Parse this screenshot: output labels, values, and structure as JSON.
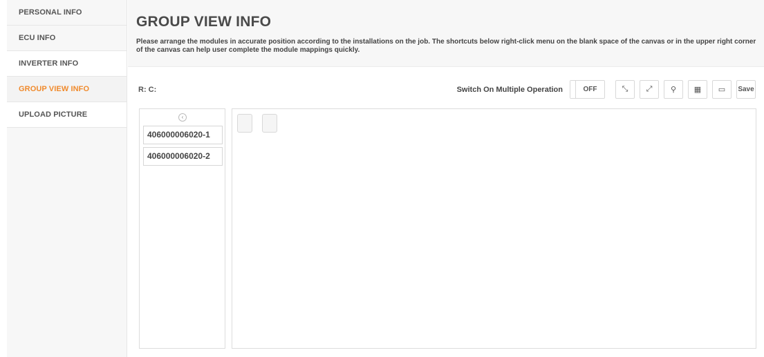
{
  "sidebar": {
    "items": [
      {
        "label": "PERSONAL INFO"
      },
      {
        "label": "ECU INFO"
      },
      {
        "label": "INVERTER INFO"
      },
      {
        "label": "GROUP VIEW INFO"
      },
      {
        "label": "UPLOAD PICTURE"
      }
    ],
    "active_color": "#f08a2c"
  },
  "header": {
    "title": "GROUP VIEW INFO",
    "description": "Please arrange the modules in accurate position according to the installations on the job. The shortcuts below right-click menu on the blank space of the canvas or in the upper right corner of the canvas can help user complete the module mappings quickly."
  },
  "toolbar": {
    "rc_label": "R: C:",
    "switch_label": "Switch On Multiple Operation",
    "toggle_state": "OFF",
    "buttons": [
      {
        "icon": "compress-arrows-icon",
        "glyph": "⤡"
      },
      {
        "icon": "expand-arrows-icon",
        "glyph": "⤢"
      },
      {
        "icon": "search-icon",
        "glyph": "⚲"
      },
      {
        "icon": "grid-icon",
        "glyph": "▦"
      },
      {
        "icon": "panel-icon",
        "glyph": "▭"
      }
    ],
    "save_label": "Save"
  },
  "module_panel": {
    "collapse_glyph": "‹",
    "items": [
      {
        "label": "406000006020-1"
      },
      {
        "label": "406000006020-2"
      }
    ]
  },
  "canvas": {
    "cells": 2
  }
}
